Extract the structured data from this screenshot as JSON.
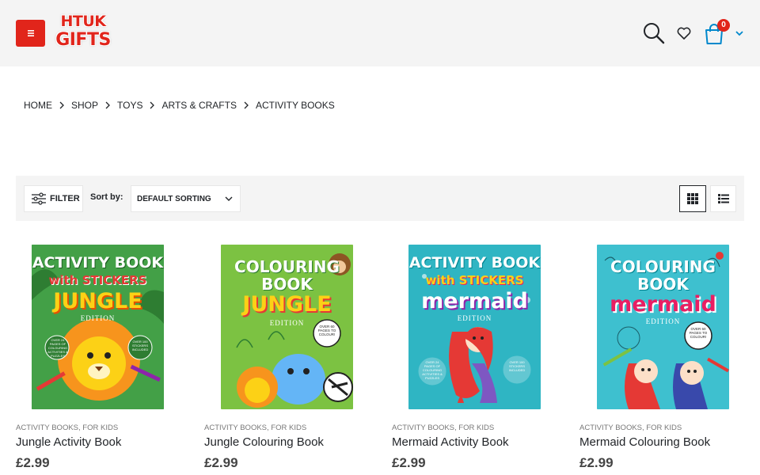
{
  "header": {
    "logo_line1": "HTUK",
    "logo_line2": "GIFTS",
    "cart_count": "0",
    "icons": [
      "menu-icon",
      "search-icon",
      "heart-icon",
      "cart-icon",
      "chevron-down-icon"
    ]
  },
  "breadcrumb": [
    "HOME",
    "SHOP",
    "TOYS",
    "ARTS & CRAFTS",
    "ACTIVITY BOOKS"
  ],
  "toolbar": {
    "filter_label": "FILTER",
    "sort_label": "Sort by:",
    "sort_value": "DEFAULT SORTING",
    "view_modes": [
      "grid-icon",
      "list-icon"
    ]
  },
  "colors": {
    "accent": "#e1251b",
    "toolbar_bg": "#f4f4f4",
    "text": "#222529"
  },
  "products": [
    {
      "categories": "ACTIVITY BOOKS, FOR KIDS",
      "name": "Jungle Activity Book",
      "price": "£2.99",
      "cover": {
        "line1": "ACTIVITY BOOK",
        "line2": "with STICKERS",
        "line3": "JUNGLE",
        "line4": "EDITION",
        "badge_left": "OVER 24 PAGES OF COLOURING ACTIVITIES & PUZZLES",
        "badge_right": "OVER 100 STICKERS INCLUDED",
        "bg": "#4caf50"
      }
    },
    {
      "categories": "ACTIVITY BOOKS, FOR KIDS",
      "name": "Jungle Colouring Book",
      "price": "£2.99",
      "cover": {
        "line1": "COLOURING",
        "line2": "BOOK",
        "line3": "JUNGLE",
        "line4": "EDITION",
        "badge_right": "OVER 60 PAGES TO COLOUR!",
        "bg": "#7cc242"
      }
    },
    {
      "categories": "ACTIVITY BOOKS, FOR KIDS",
      "name": "Mermaid Activity Book",
      "price": "£2.99",
      "cover": {
        "line1": "ACTIVITY BOOK",
        "line2": "with STICKERS",
        "line3": "mermaid",
        "line4": "EDITION",
        "badge_left": "OVER 24 PAGES OF COLOURING ACTIVITIES & PUZZLES",
        "badge_right": "OVER 100 STICKERS INCLUDED",
        "bg": "#2fb5c3"
      }
    },
    {
      "categories": "ACTIVITY BOOKS, FOR KIDS",
      "name": "Mermaid Colouring Book",
      "price": "£2.99",
      "cover": {
        "line1": "COLOURING",
        "line2": "BOOK",
        "line3": "mermaid",
        "line4": "EDITION",
        "badge_right": "OVER 60 PAGES TO COLOUR!",
        "bg": "#3ec0cf"
      }
    }
  ]
}
